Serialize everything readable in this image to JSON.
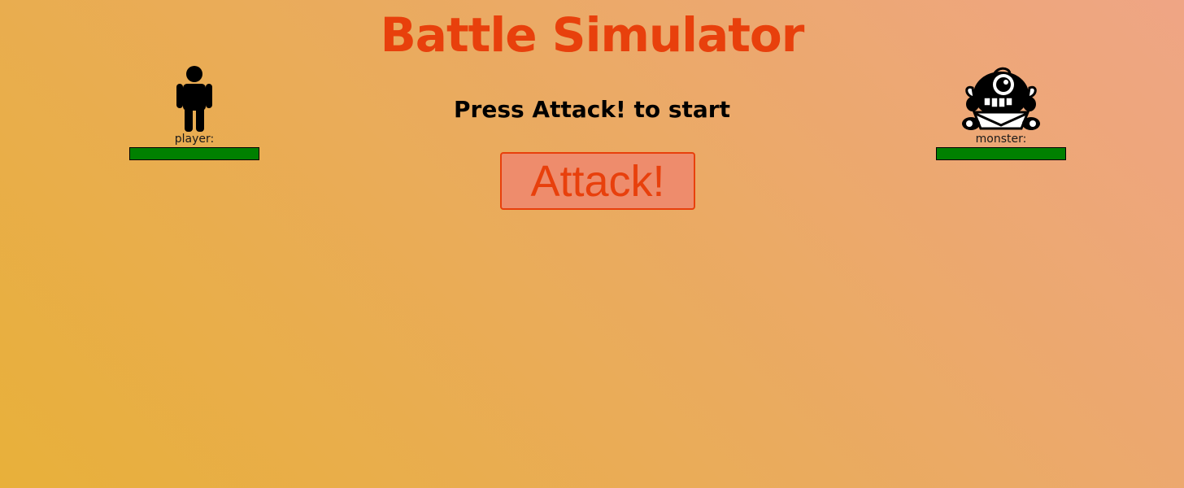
{
  "title": "Battle Simulator",
  "status": "Press Attack! to start",
  "attack_label": "Attack!",
  "player": {
    "label": "player:",
    "icon": "person-icon",
    "health_percent": 100
  },
  "monster": {
    "label": "monster:",
    "icon": "one-eyed-monster-icon",
    "health_percent": 100
  },
  "colors": {
    "accent": "#e8400c",
    "health": "#008000",
    "button_bg": "#ee8c6c"
  }
}
